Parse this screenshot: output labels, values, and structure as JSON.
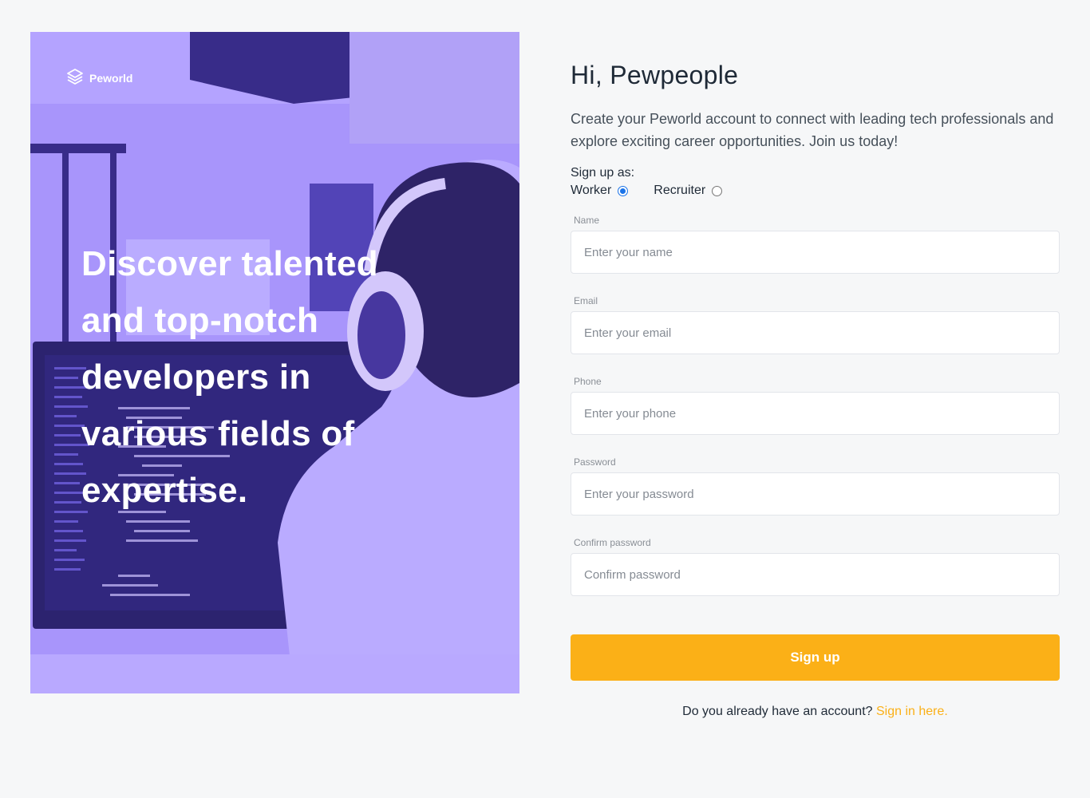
{
  "hero": {
    "brand_name": "Peworld",
    "headline": "Discover talented and top-notch developers in various fields of expertise."
  },
  "form": {
    "title": "Hi, Pewpeople",
    "description": "Create your Peworld account to connect with leading tech professionals and explore exciting career opportunities. Join us today!",
    "role_label": "Sign up as:",
    "roles": [
      {
        "label": "Worker",
        "checked": true
      },
      {
        "label": "Recruiter",
        "checked": false
      }
    ],
    "fields": {
      "name": {
        "label": "Name",
        "placeholder": "Enter your name",
        "value": ""
      },
      "email": {
        "label": "Email",
        "placeholder": "Enter your email",
        "value": ""
      },
      "phone": {
        "label": "Phone",
        "placeholder": "Enter your phone",
        "value": ""
      },
      "password": {
        "label": "Password",
        "placeholder": "Enter your password",
        "value": ""
      },
      "confirm_password": {
        "label": "Confirm password",
        "placeholder": "Confirm password",
        "value": ""
      }
    },
    "submit_label": "Sign up",
    "signin_prompt": "Do you already have an account?",
    "signin_link": "Sign in here."
  },
  "colors": {
    "accent": "#fbb017",
    "hero_tint": "#9b88f3",
    "background": "#f6f7f8",
    "radio_checked": "#1a73e8"
  },
  "icons": {
    "brand": "stacked-layers-icon"
  }
}
